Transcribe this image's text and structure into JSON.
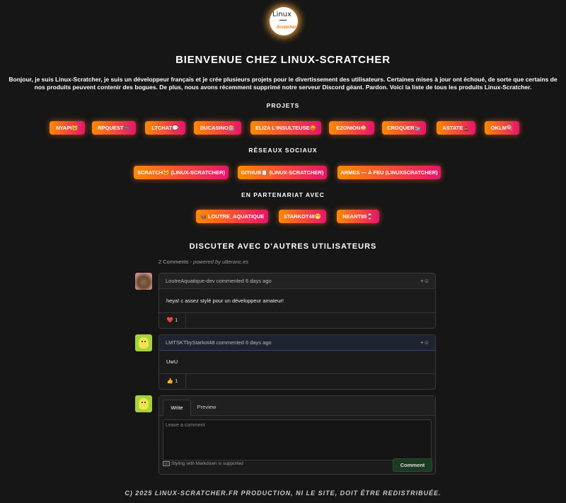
{
  "logo": {
    "line1": "Linux",
    "line2": "Scratcher"
  },
  "title": "BIENVENUE CHEZ LINUX-SCRATCHER",
  "intro": "Bonjour, je suis Linux-Scratcher, je suis un développeur français et je crée plusieurs projets pour le divertissement des utilisateurs. Certaines mises à jour ont échoué, de sorte que certains de nos produits peuvent contenir des bogues. De plus, nous avons récemment supprimé notre serveur Discord géant. Pardon. Voici la liste de tous les produits Linux-Scratcher.",
  "projects": {
    "heading": "PROJETS",
    "items": [
      "NYAPI😺",
      "RPQUEST🎮",
      "LTCHAT💬",
      "DUCASINO🎰",
      "ELIZA L'INSULTEUSE😡",
      "EZONION🧅",
      "CROQUER📚",
      "ASTATE💄",
      "OKLM🍭"
    ]
  },
  "social": {
    "heading": "RÉSEAUX SOCIAUX",
    "items": [
      "SCRATCH😺 (LINUX-SCRATCHER)",
      "GITHUB📋 (LINUX-SCRATCHER)",
      "ARMES — À FEU (LINUXSCRATCHER)"
    ]
  },
  "partners": {
    "heading": "EN PARTENARIAT AVEC",
    "items": [
      "🦦 LOUTRE_AQUATIQUE",
      "STARKOT48😁",
      "NEANT85🍷"
    ]
  },
  "discussion": {
    "heading": "DISCUTER AVEC D'AUTRES UTILISATEURS",
    "count": "2 Comments",
    "powered": " - powered by utteranc.es",
    "comments": [
      {
        "author": "LoutreAquatique-dev",
        "meta": " commented 6 days ago",
        "text": "heya! c assez stylé pour un développeur amateur!",
        "reaction": "❤️ 1"
      },
      {
        "author": "LMTSKTbyStarkot48",
        "meta": " commented 6 days ago",
        "text": "UwU",
        "reaction": "👍 1"
      }
    ],
    "reply": {
      "tab_write": "Write",
      "tab_preview": "Preview",
      "placeholder": "Leave a comment",
      "markdown_note": "Styling with Markdown is supported",
      "markdown_icon": "MD",
      "submit": "Comment"
    }
  },
  "footer": "C) 2025 LINUX-SCRATCHER.FR PRODUCTION, NI LE SITE, DOIT ÊTRE REDISTRIBUÉE.",
  "colors": {
    "background": "#161616",
    "gradient_start": "#ff8a00",
    "gradient_end": "#e8136e",
    "submit_green": "#1b3a24"
  },
  "icons": {
    "add_reaction": "smiley-plus-icon"
  }
}
